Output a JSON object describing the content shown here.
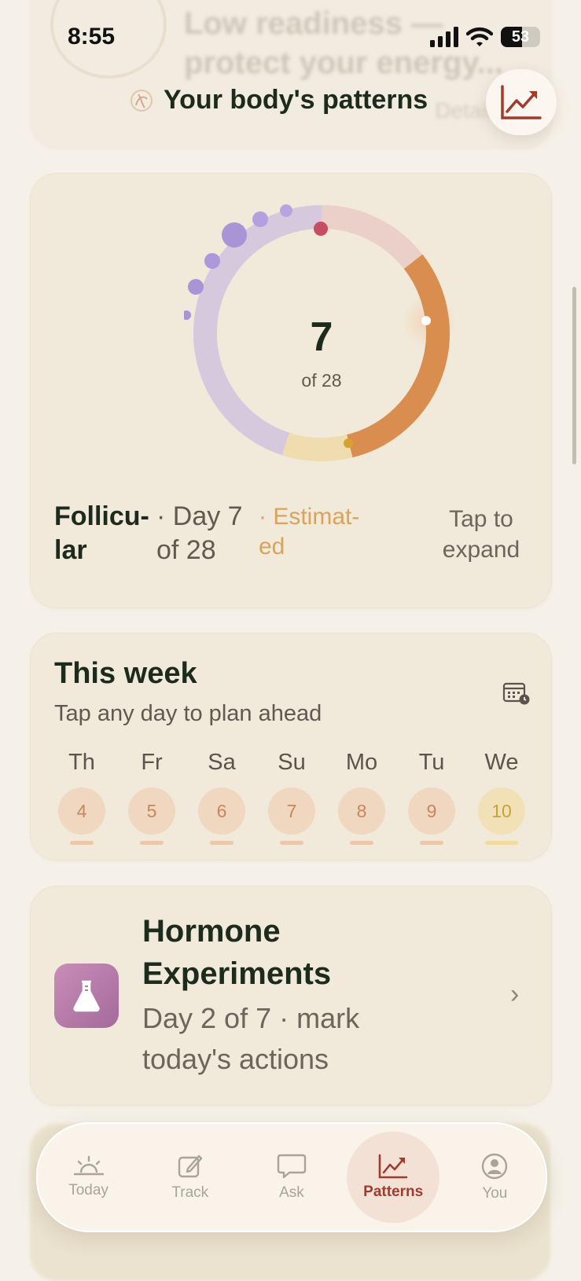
{
  "status_bar": {
    "time": "8:55",
    "battery": "53",
    "battery_level": 0.53
  },
  "background_card": {
    "line1": "Low readiness —",
    "line2": "protect your energy...",
    "detail": "Details"
  },
  "header": {
    "title": "Your body's patterns"
  },
  "cycle": {
    "day": "7",
    "of_label": "of 28",
    "current_day": 7,
    "cycle_length": 28,
    "phase": "Follicu-lar",
    "day_of": "· Day 7 of 28",
    "estimated": "· Estimat-ed",
    "tap_hint": "Tap to expand",
    "colors": {
      "menstrual": "#ead0c8",
      "follicular": "#d98d4e",
      "ovulation": "#efddb0",
      "luteal": "#d6c9de"
    }
  },
  "week": {
    "title": "This week",
    "subtitle": "Tap any day to plan ahead",
    "days": [
      {
        "name": "Th",
        "num": "4"
      },
      {
        "name": "Fr",
        "num": "5"
      },
      {
        "name": "Sa",
        "num": "6"
      },
      {
        "name": "Su",
        "num": "7"
      },
      {
        "name": "Mo",
        "num": "8"
      },
      {
        "name": "Tu",
        "num": "9"
      },
      {
        "name": "We",
        "num": "10"
      }
    ]
  },
  "hormone": {
    "title": "Hormone Experiments",
    "subtitle": "Day 2 of 7 · mark today's actions"
  },
  "tabs": [
    {
      "label": "Today",
      "icon": "sunrise-icon"
    },
    {
      "label": "Track",
      "icon": "edit-icon"
    },
    {
      "label": "Ask",
      "icon": "chat-icon"
    },
    {
      "label": "Patterns",
      "icon": "trend-icon"
    },
    {
      "label": "You",
      "icon": "user-icon"
    }
  ]
}
